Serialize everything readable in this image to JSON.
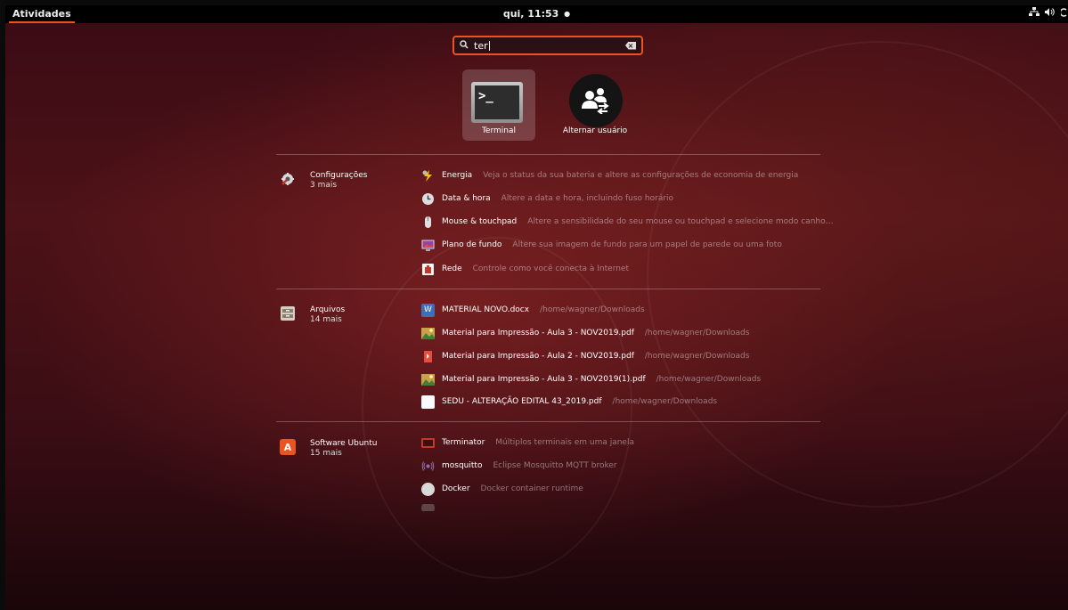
{
  "topbar": {
    "activities": "Atividades",
    "clock": "qui, 11:53",
    "clock_dot": "●"
  },
  "search": {
    "value": "ter",
    "search_icon": "search-icon",
    "clear_icon": "backspace-icon"
  },
  "apps": [
    {
      "label": "Terminal",
      "icon": "terminal-icon",
      "prompt": ">_"
    },
    {
      "label": "Alternar usuário",
      "icon": "switch-user-icon"
    }
  ],
  "providers": {
    "settings": {
      "name": "Configurações",
      "more": "3 mais",
      "results": [
        {
          "title": "Energia",
          "desc": "Veja o status da sua bateria e altere as configurações de economia de energia",
          "icon": "power-icon"
        },
        {
          "title": "Data & hora",
          "desc": "Altere a data e hora, incluindo fuso horário",
          "icon": "clock-icon"
        },
        {
          "title": "Mouse & touchpad",
          "desc": "Altere a sensibilidade do seu mouse ou touchpad e selecione modo canho…",
          "icon": "mouse-icon"
        },
        {
          "title": "Plano de fundo",
          "desc": "Altere sua imagem de fundo para um papel de parede ou uma foto",
          "icon": "wallpaper-icon"
        },
        {
          "title": "Rede",
          "desc": "Controle como você conecta à Internet",
          "icon": "network-icon"
        }
      ]
    },
    "files": {
      "name": "Arquivos",
      "more": "14 mais",
      "results": [
        {
          "title": "MATERIAL NOVO.docx",
          "desc": "/home/wagner/Downloads",
          "icon": "word-document-icon"
        },
        {
          "title": "Material para Impressão - Aula 3 - NOV2019.pdf",
          "desc": "/home/wagner/Downloads",
          "icon": "pdf-image-icon"
        },
        {
          "title": "Material para Impressão - Aula 2 - NOV2019.pdf",
          "desc": "/home/wagner/Downloads",
          "icon": "pdf-icon"
        },
        {
          "title": "Material para Impressão - Aula 3 - NOV2019(1).pdf",
          "desc": "/home/wagner/Downloads",
          "icon": "pdf-image-icon"
        },
        {
          "title": "SEDU - ALTERAÇÃO EDITAL 43_2019.pdf",
          "desc": "/home/wagner/Downloads",
          "icon": "blank-document-icon"
        }
      ]
    },
    "software": {
      "name": "Software Ubuntu",
      "more": "15 mais",
      "results": [
        {
          "title": "Terminator",
          "desc": "Múltiplos terminais em uma janela",
          "icon": "terminator-icon"
        },
        {
          "title": "mosquitto",
          "desc": "Eclipse Mosquitto MQTT broker",
          "icon": "mosquitto-icon"
        },
        {
          "title": "Docker",
          "desc": "Docker container runtime",
          "icon": "docker-icon"
        }
      ]
    }
  },
  "colors": {
    "accent": "#e95420",
    "panel": "#000000"
  }
}
